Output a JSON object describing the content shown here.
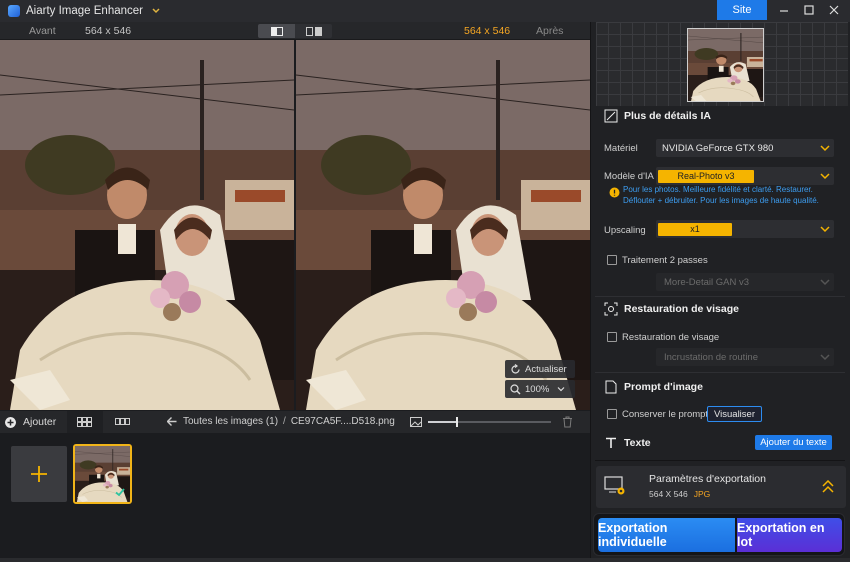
{
  "app": {
    "title": "Aiarty Image Enhancer",
    "site_button": "Site"
  },
  "compare": {
    "before_label": "Avant",
    "after_label": "Après",
    "size_left": "564 x 546",
    "size_right": "564 x 546"
  },
  "viewer": {
    "refresh_label": "Actualiser",
    "zoom_label": "100%"
  },
  "bottombar": {
    "add_label": "Ajouter",
    "breadcrumb_all": "Toutes les images (1)",
    "breadcrumb_sep": "/",
    "breadcrumb_file": "CE97CA5F....D518.png",
    "zoom_slider_fraction": 0.23
  },
  "panel": {
    "ai_details": {
      "title": "Plus de détails IA",
      "hardware_label": "Matériel",
      "hardware_value": "NVIDIA GeForce GTX 980",
      "model_label": "Modèle d'IA",
      "model_value": "Real-Photo  v3",
      "model_info": "Pour les photos. Meilleure fidélité et clarté. Restaurer. Déflouter + débruiter. Pour les images de haute qualité.",
      "upscaling_label": "Upscaling",
      "upscaling_value": "x1",
      "two_pass_label": "Traitement 2 passes",
      "two_pass_model": "More-Detail GAN  v3"
    },
    "face": {
      "title": "Restauration de visage",
      "checkbox_label": "Restauration de visage",
      "model": "Incrustation de routine"
    },
    "prompt": {
      "title": "Prompt d'image",
      "keep_label": "Conserver le prompt",
      "view_button": "Visualiser"
    },
    "text": {
      "title": "Texte",
      "add_button": "Ajouter du texte"
    },
    "export": {
      "title": "Paramètres d'exportation",
      "size": "564 X 546",
      "format": "JPG",
      "single_button": "Exportation individuelle",
      "batch_button": "Exportation en lot"
    }
  },
  "colors": {
    "accent_blue": "#1e7ae8",
    "accent_yellow": "#f5b400",
    "info_blue": "#3d9df0",
    "batch_purple": "#4b3fdf"
  }
}
